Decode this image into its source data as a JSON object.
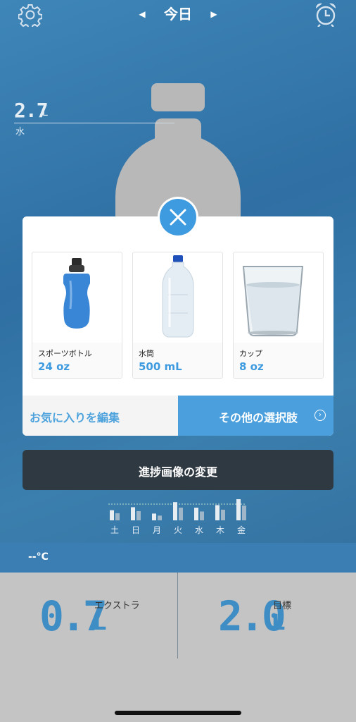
{
  "header": {
    "title": "今日",
    "prev_icon": "triangle-left-icon",
    "next_icon": "triangle-right-icon",
    "settings_icon": "gear-icon",
    "alarm_icon": "alarm-clock-icon"
  },
  "scale_marker": {
    "value": "2.7",
    "unit": "L",
    "label": "水"
  },
  "popup": {
    "close_icon": "close-icon",
    "containers": [
      {
        "name": "スポーツボトル",
        "volume": "24 oz",
        "image": "sports-bottle",
        "color": "#3a86d6"
      },
      {
        "name": "水筒",
        "volume": "500 mL",
        "image": "plastic-water-bottle",
        "color": "#d9e6f0"
      },
      {
        "name": "カップ",
        "volume": "8 oz",
        "image": "water-glass",
        "color": "#e6eef2"
      }
    ],
    "edit_favorites_label": "お気に入りを編集",
    "more_options_label": "その他の選択肢"
  },
  "change_image_label": "進捗画像の変更",
  "weekly_chart": {
    "days": [
      "土",
      "日",
      "月",
      "火",
      "水",
      "木",
      "金"
    ],
    "intake_fraction": [
      0.48,
      0.62,
      0.32,
      0.86,
      0.6,
      0.72,
      1.0
    ]
  },
  "temperature": "--°C",
  "stats": {
    "extra_value": "0.7",
    "extra_unit": "L",
    "extra_label": "エクストラ",
    "goal_value": "2.0",
    "goal_unit": "L",
    "goal_label": "目標"
  },
  "colors": {
    "accent": "#3e9be0",
    "background": "#3575a8",
    "dark_button": "#2f3942"
  }
}
